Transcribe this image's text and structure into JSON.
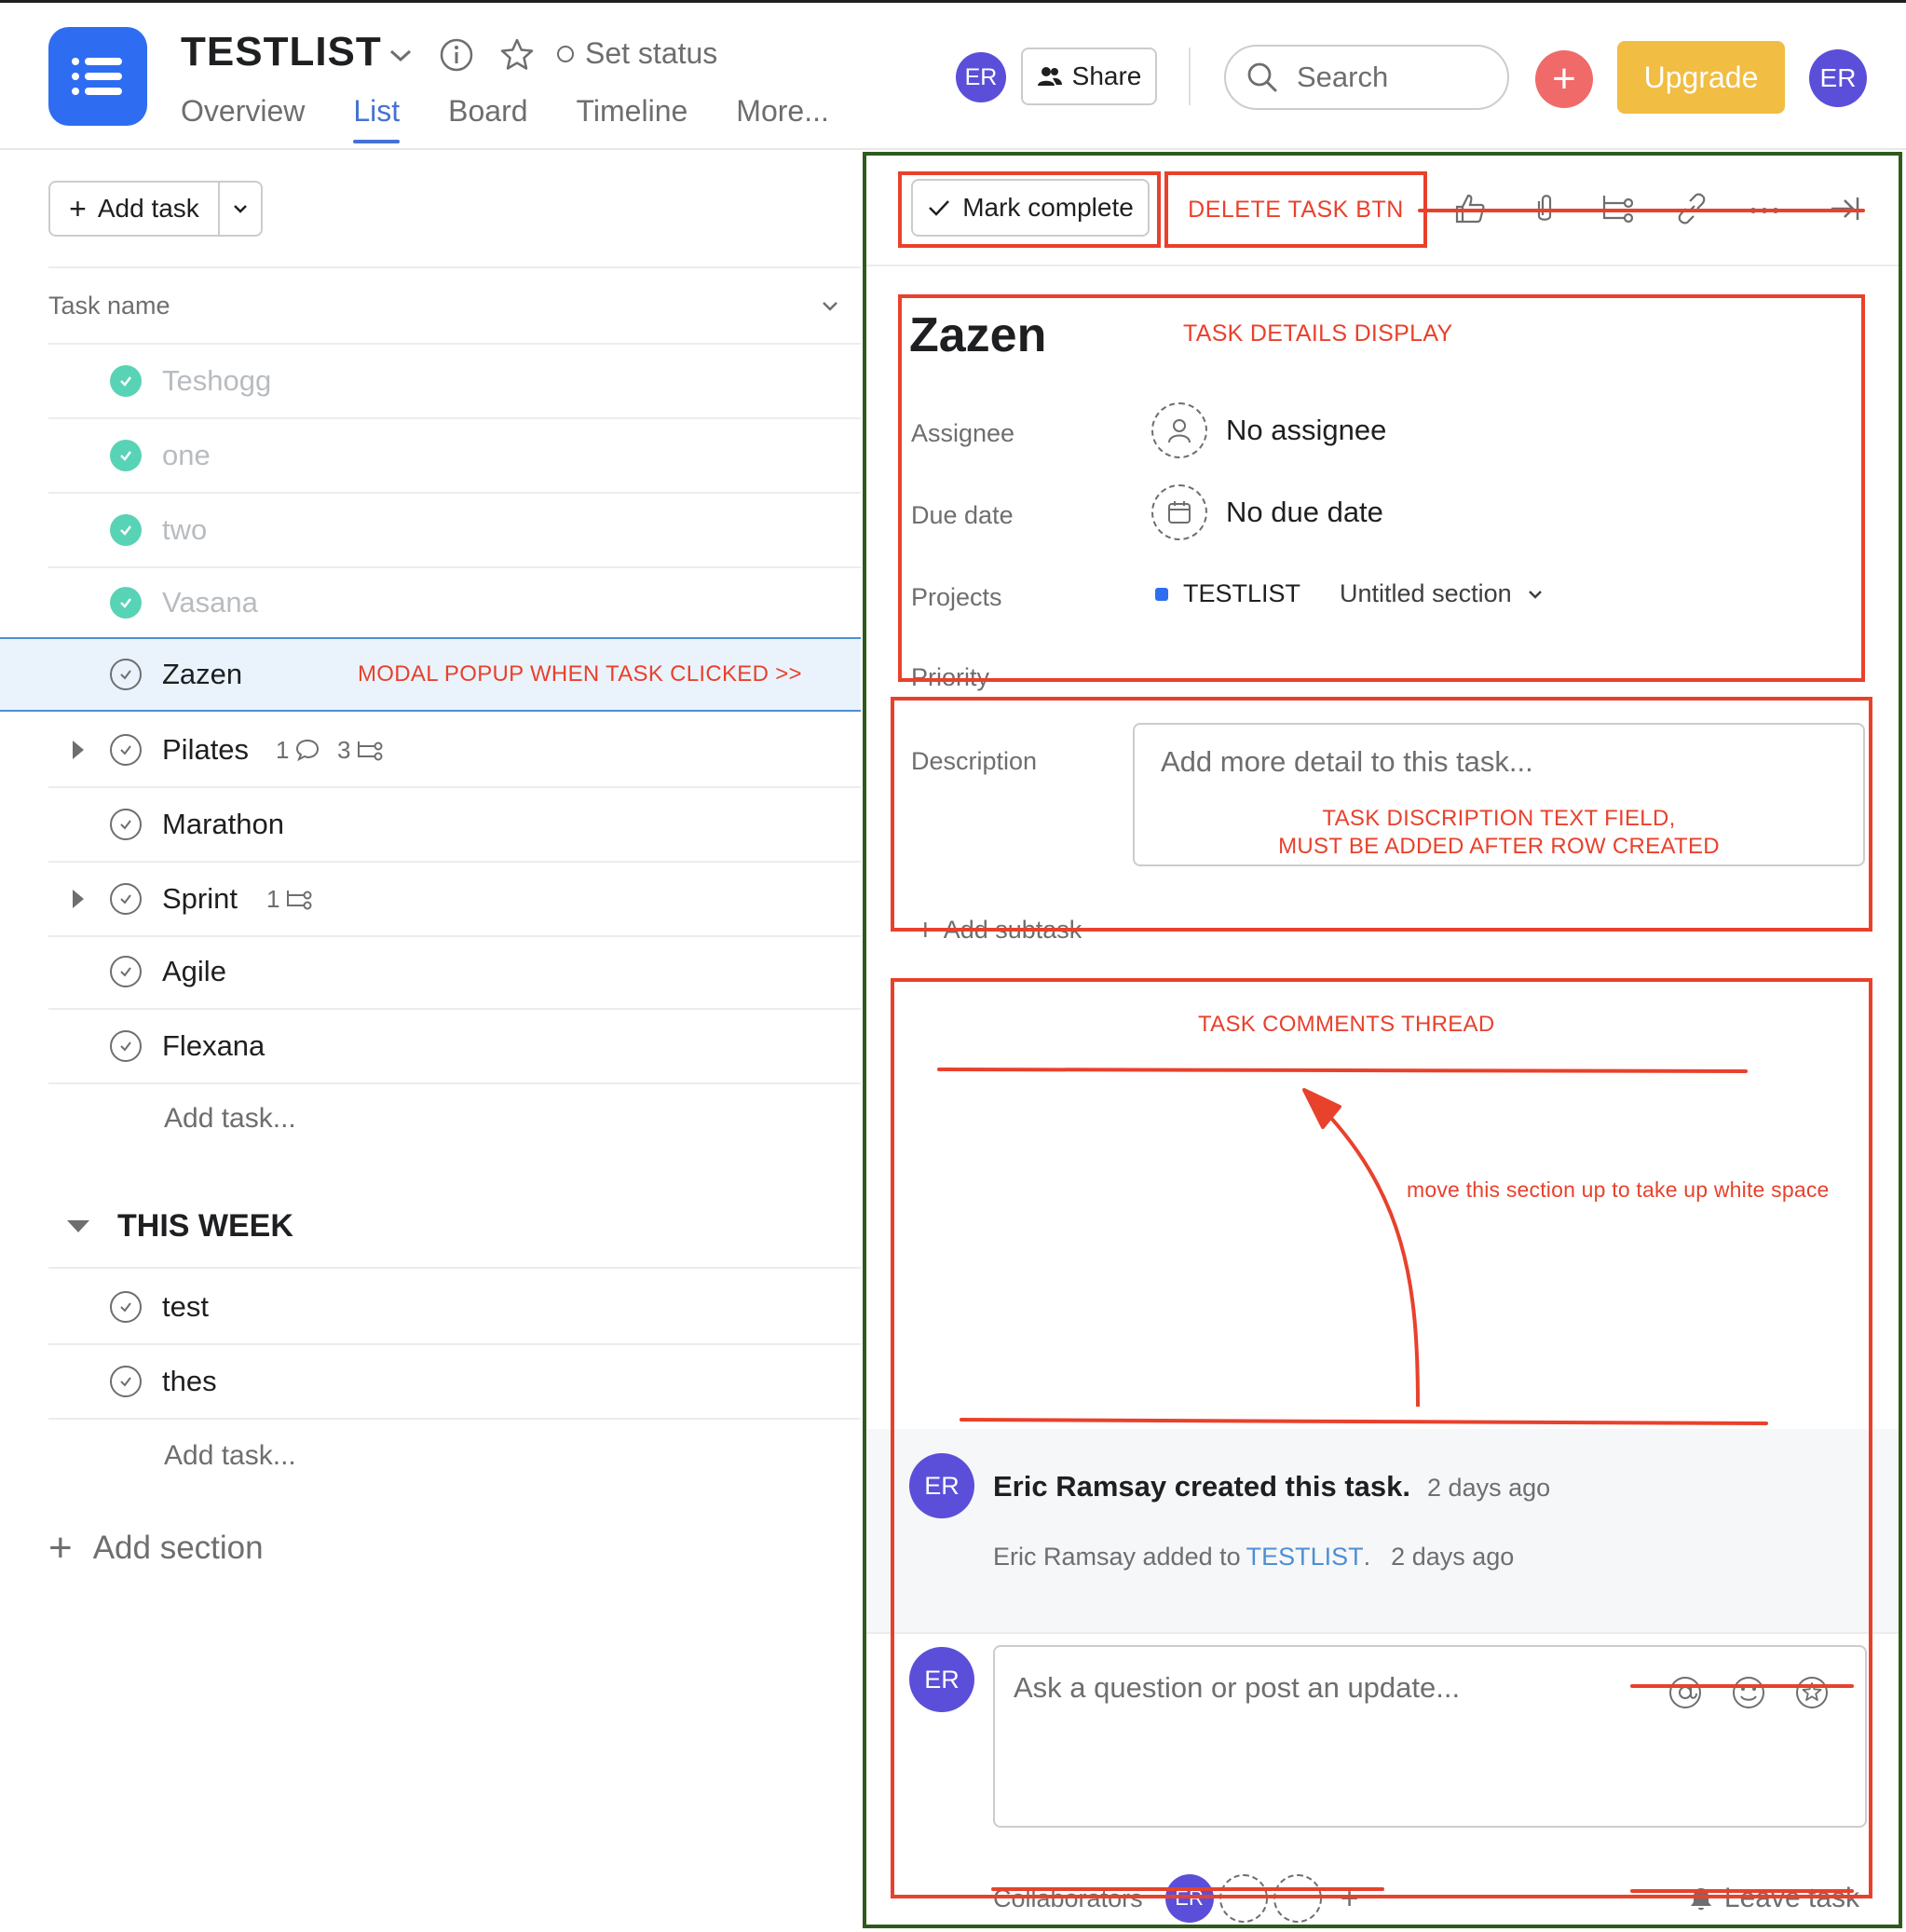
{
  "header": {
    "project_title": "TESTLIST",
    "set_status_label": "Set status",
    "tabs": [
      {
        "label": "Overview",
        "active": false
      },
      {
        "label": "List",
        "active": true
      },
      {
        "label": "Board",
        "active": false
      },
      {
        "label": "Timeline",
        "active": false
      },
      {
        "label": "More..."
      }
    ],
    "avatar_initials": "ER",
    "share_label": "Share",
    "search_placeholder": "Search",
    "plus_label": "+",
    "upgrade_label": "Upgrade",
    "user_initials": "ER",
    "colors": {
      "logo": "#2e6df1",
      "upgrade": "#f1bd42",
      "plus": "#f06a6a",
      "avatar": "#5b4fd9",
      "active_tab": "#4573d2"
    }
  },
  "list": {
    "add_task_label": "Add task",
    "column_header": "Task name",
    "tasks": [
      {
        "name": "Teshogg",
        "completed": true
      },
      {
        "name": "one",
        "completed": true
      },
      {
        "name": "two",
        "completed": true
      },
      {
        "name": "Vasana",
        "completed": true
      },
      {
        "name": "Zazen",
        "completed": false,
        "selected": true
      },
      {
        "name": "Pilates",
        "completed": false,
        "comments": "1",
        "subtasks": "3"
      },
      {
        "name": "Marathon",
        "completed": false
      },
      {
        "name": "Sprint",
        "completed": false,
        "subtasks": "1"
      },
      {
        "name": "Agile",
        "completed": false
      },
      {
        "name": "Flexana",
        "completed": false
      }
    ],
    "add_task_inline": "Add task...",
    "section": {
      "title": "THIS WEEK",
      "tasks": [
        {
          "name": "test",
          "completed": false
        },
        {
          "name": "thes",
          "completed": false
        }
      ],
      "add_task_inline": "Add task..."
    },
    "add_section_label": "Add section"
  },
  "detail": {
    "mark_complete_label": "Mark complete",
    "title": "Zazen",
    "fields": {
      "assignee_label": "Assignee",
      "assignee_value": "No assignee",
      "due_label": "Due date",
      "due_value": "No due date",
      "projects_label": "Projects",
      "project_name": "TESTLIST",
      "project_section": "Untitled section",
      "priority_label": "Priority"
    },
    "description_label": "Description",
    "description_placeholder": "Add more detail to this task...",
    "add_subtask_label": "Add subtask",
    "activity": {
      "avatar_initials": "ER",
      "created_text": "Eric Ramsay created this task.",
      "created_time": "2 days ago",
      "added_prefix": "Eric Ramsay added to",
      "added_link": "TESTLIST",
      "added_suffix": ".",
      "added_time": "2 days ago"
    },
    "comment": {
      "avatar_initials": "ER",
      "placeholder": "Ask a question or post an update..."
    },
    "collaborators_label": "Collaborators",
    "collaborator_initials": "ER",
    "collab_plus": "+",
    "leave_task_label": "Leave task"
  },
  "annotations": {
    "modal_note": "MODAL POPUP WHEN TASK CLICKED >>",
    "delete_btn": "DELETE TASK BTN",
    "task_details": "TASK DETAILS DISPLAY",
    "desc_note_line1": "TASK DISCRIPTION TEXT FIELD,",
    "desc_note_line2": "MUST BE ADDED AFTER ROW CREATED",
    "comments_thread": "TASK COMMENTS THREAD",
    "move_note": "move this section up to take up white space",
    "color": "#e8412c"
  }
}
